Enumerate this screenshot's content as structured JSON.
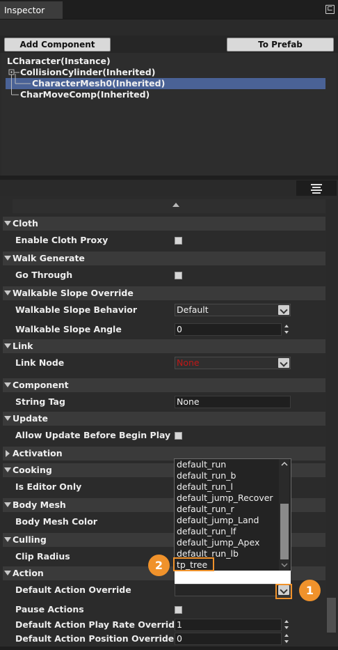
{
  "window": {
    "tab_title": "Inspector",
    "dock_icon": "pin-icon"
  },
  "buttons": {
    "add_component": "Add Component",
    "to_prefab": "To Prefab"
  },
  "tree": {
    "items": [
      {
        "label": "LCharacter(Instance)",
        "selected": false
      },
      {
        "label": "CollisionCylinder(Inherited)",
        "selected": false
      },
      {
        "label": "CharacterMesh0(Inherited)",
        "selected": true
      },
      {
        "label": "CharMoveComp(Inherited)",
        "selected": false
      }
    ]
  },
  "categories": {
    "cloth": "Cloth",
    "walk_generate": "Walk Generate",
    "walkable_slope": "Walkable Slope Override",
    "link": "Link",
    "component": "Component",
    "update": "Update",
    "activation": "Activation",
    "cooking": "Cooking",
    "body_mesh": "Body Mesh",
    "culling": "Culling",
    "action": "Action"
  },
  "properties": {
    "enable_cloth_proxy": "Enable Cloth Proxy",
    "go_through": "Go Through",
    "walkable_slope_behavior": "Walkable Slope Behavior",
    "walkable_slope_behavior_value": "Default",
    "walkable_slope_angle": "Walkable Slope Angle",
    "walkable_slope_angle_value": "0",
    "link_node": "Link Node",
    "link_node_value": "None",
    "string_tag": "String Tag",
    "string_tag_value": "None",
    "allow_update": "Allow Update Before Begin Play",
    "is_editor_only": "Is Editor Only",
    "body_mesh_color": "Body Mesh Color",
    "clip_radius": "Clip Radius",
    "default_action_override": "Default Action Override",
    "pause_actions": "Pause Actions",
    "play_rate_override": "Default Action Play Rate Override",
    "play_rate_value": "1",
    "position_override": "Default Action Position Override",
    "position_value": "0"
  },
  "dropdown": {
    "options": [
      "default_run",
      "default_run_b",
      "default_run_l",
      "default_jump_Recover",
      "default_run_r",
      "default_jump_Land",
      "default_run_lf",
      "default_jump_Apex",
      "default_run_lb",
      "tp_tree"
    ]
  },
  "annotations": {
    "badge1": "1",
    "badge2": "2"
  },
  "colors": {
    "accent_orange": "#f0922b",
    "selection": "#4a6296",
    "none_red": "#c01818"
  }
}
